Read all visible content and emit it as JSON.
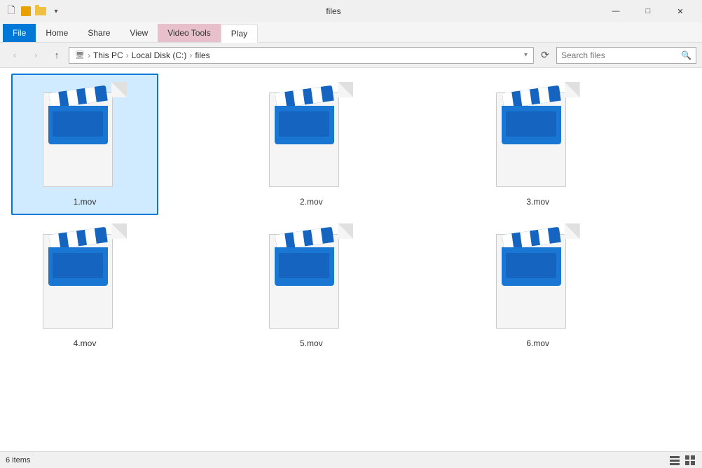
{
  "titleBar": {
    "title": "files",
    "minimizeLabel": "—",
    "maximizeLabel": "□",
    "closeLabel": "✕"
  },
  "ribbon": {
    "tabs": [
      {
        "id": "file",
        "label": "File",
        "active": true,
        "style": "file"
      },
      {
        "id": "home",
        "label": "Home",
        "active": false,
        "style": "normal"
      },
      {
        "id": "share",
        "label": "Share",
        "active": false,
        "style": "normal"
      },
      {
        "id": "view",
        "label": "View",
        "active": false,
        "style": "normal"
      },
      {
        "id": "videotools",
        "label": "Video Tools",
        "active": true,
        "style": "video"
      },
      {
        "id": "play",
        "label": "Play",
        "active": false,
        "style": "highlighted"
      }
    ]
  },
  "addressBar": {
    "backLabel": "‹",
    "forwardLabel": "›",
    "upLabel": "↑",
    "refreshLabel": "⟳",
    "pathParts": [
      "This PC",
      "Local Disk (C:)",
      "files"
    ],
    "searchPlaceholder": "Search files",
    "searchLabel": "Search",
    "dropdownLabel": "▾"
  },
  "files": [
    {
      "id": "1",
      "name": "1.mov",
      "selected": true
    },
    {
      "id": "2",
      "name": "2.mov",
      "selected": false
    },
    {
      "id": "3",
      "name": "3.mov",
      "selected": false
    },
    {
      "id": "4",
      "name": "4.mov",
      "selected": false
    },
    {
      "id": "5",
      "name": "5.mov",
      "selected": false
    },
    {
      "id": "6",
      "name": "6.mov",
      "selected": false
    }
  ],
  "statusBar": {
    "itemCount": "6 items"
  },
  "colors": {
    "accent": "#0078d7",
    "clapperBlue": "#1976d2",
    "clapperDark": "#1565c0",
    "stripeWhite": "#ffffff"
  }
}
